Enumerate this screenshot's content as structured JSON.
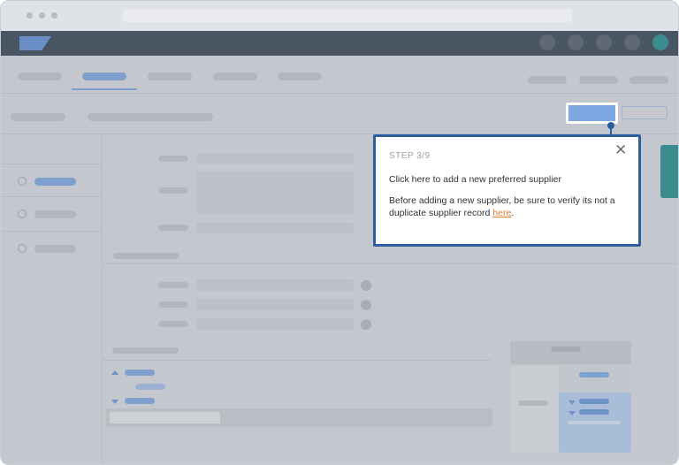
{
  "tooltip": {
    "step_label": "STEP 3/9",
    "close_glyph": "✕",
    "title": "Click here to add a new preferred supplier",
    "body_text": "Before adding a new supplier, be sure to verify its not a duplicate supplier record ",
    "link_text": "here",
    "after_link": "."
  },
  "colors": {
    "accent": "#2c5fa0",
    "link": "#e07b39",
    "highlight_button": "#7ea6e0",
    "appbar": "#4a5563",
    "overlay": "#c4c8ce"
  },
  "icons": [
    "close-icon",
    "info-icon",
    "radio-icon",
    "caret-up-icon",
    "caret-down-icon",
    "avatar-icon",
    "logo"
  ]
}
